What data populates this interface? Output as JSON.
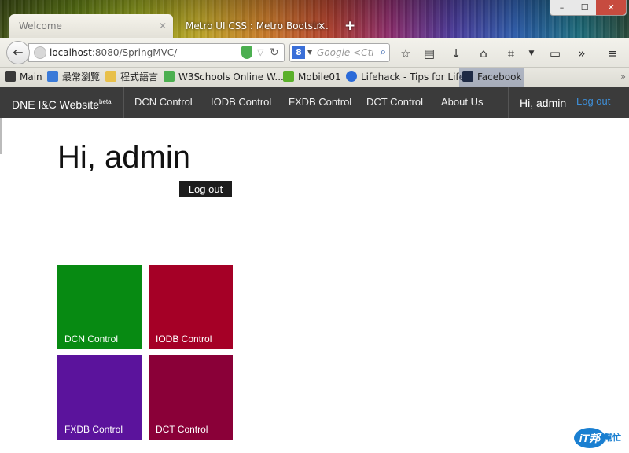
{
  "browser": {
    "tabs": [
      {
        "title": "Welcome",
        "active": true
      },
      {
        "title": "Metro UI CSS : Metro Bootstr...",
        "active": false
      }
    ],
    "new_tab": "+",
    "url_host": "localhost",
    "url_rest": ":8080/SpringMVC/",
    "search_placeholder": "Google <Ctrl+K>",
    "search_engine_letter": "8",
    "window_controls": [
      "–",
      "☐",
      "✕"
    ],
    "bookmarks": [
      {
        "label": "Main",
        "icon": "folder-icon",
        "color": "#3a3a3a"
      },
      {
        "label": "最常瀏覽",
        "icon": "globe-icon",
        "color": "#3a7ad8"
      },
      {
        "label": "程式語言",
        "icon": "folder-icon",
        "color": "#e8c04a"
      },
      {
        "label": "W3Schools Online W...",
        "icon": "chart-icon",
        "color": "#4caf50"
      },
      {
        "label": "Mobile01",
        "icon": "m-icon",
        "color": "#5ab02a"
      },
      {
        "label": "Lifehack - Tips for Life",
        "icon": "lifehack-icon",
        "color": "#2a6ad8"
      },
      {
        "label": "Facebook",
        "icon": "facebook-icon",
        "color": "#1e2a44"
      }
    ],
    "bookmarks_more": "»"
  },
  "navbar": {
    "brand": "DNE I&C Website",
    "brand_sup": "beta",
    "items": [
      "DCN Control",
      "IODB Control",
      "FXDB Control",
      "DCT Control",
      "About Us"
    ],
    "user": "Hi, admin",
    "logout": "Log out",
    "bg_color": "#3b3b3b",
    "link_color": "#3e8fd8"
  },
  "main": {
    "greeting": "Hi, admin",
    "logout_button": "Log out",
    "tiles": [
      {
        "label": "DCN Control",
        "color": "#078a12"
      },
      {
        "label": "IODB Control",
        "color": "#a50026"
      },
      {
        "label": "FXDB Control",
        "color": "#5b139c"
      },
      {
        "label": "DCT Control",
        "color": "#8a0038"
      }
    ]
  },
  "watermark": {
    "logo_text": "iT邦",
    "text": "幫忙"
  }
}
